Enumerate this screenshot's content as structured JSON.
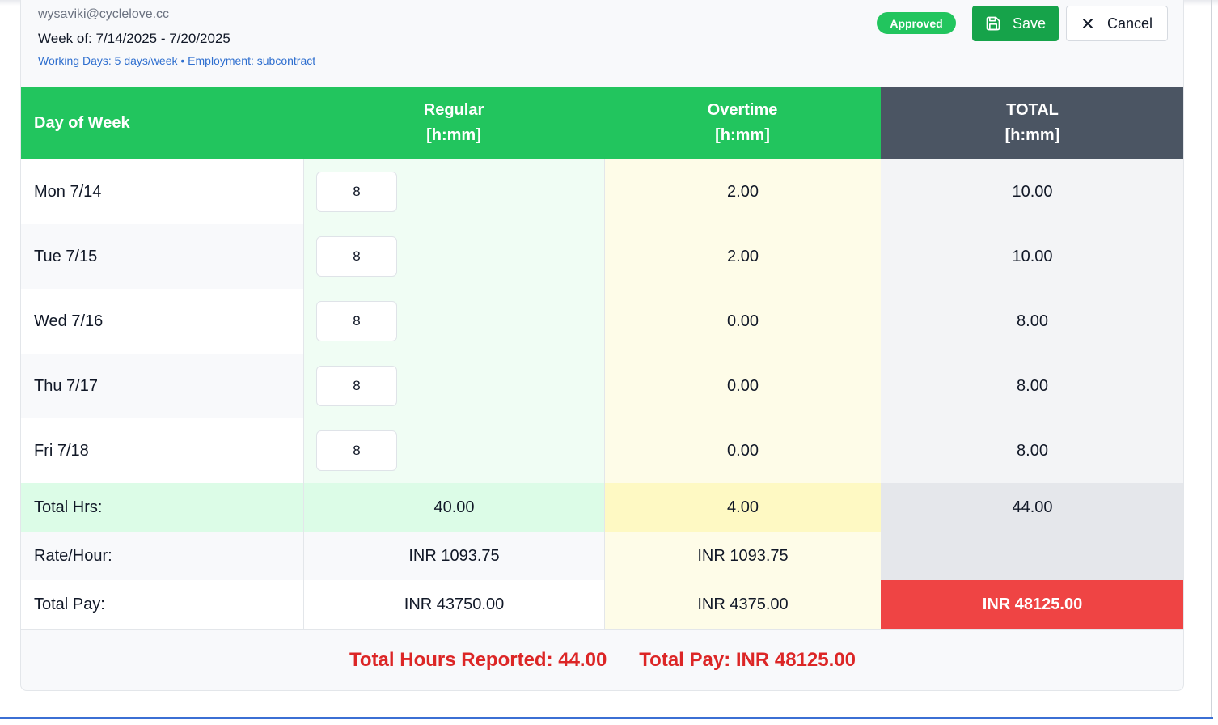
{
  "header": {
    "email": "wysaviki@cyclelove.cc",
    "week": "Week of: 7/14/2025 - 7/20/2025",
    "info": "Working Days: 5 days/week • Employment: subcontract",
    "status_badge": "Approved",
    "save_label": "Save",
    "cancel_label": "Cancel"
  },
  "table": {
    "headers": {
      "day": "Day of Week",
      "regular": "Regular",
      "regular_unit": "[h:mm]",
      "overtime": "Overtime",
      "overtime_unit": "[h:mm]",
      "total": "TOTAL",
      "total_unit": "[h:mm]"
    },
    "rows": [
      {
        "day": "Mon 7/14",
        "regular": "8",
        "overtime": "2.00",
        "total": "10.00"
      },
      {
        "day": "Tue 7/15",
        "regular": "8",
        "overtime": "2.00",
        "total": "10.00"
      },
      {
        "day": "Wed 7/16",
        "regular": "8",
        "overtime": "0.00",
        "total": "8.00"
      },
      {
        "day": "Thu 7/17",
        "regular": "8",
        "overtime": "0.00",
        "total": "8.00"
      },
      {
        "day": "Fri 7/18",
        "regular": "8",
        "overtime": "0.00",
        "total": "8.00"
      }
    ],
    "total_hrs": {
      "label": "Total Hrs:",
      "regular": "40.00",
      "overtime": "4.00",
      "total": "44.00"
    },
    "rate": {
      "label": "Rate/Hour:",
      "regular": "INR 1093.75",
      "overtime": "INR 1093.75",
      "total": ""
    },
    "total_pay": {
      "label": "Total Pay:",
      "regular": "INR 43750.00",
      "overtime": "INR 4375.00",
      "total": "INR 48125.00"
    }
  },
  "footer": {
    "hours_reported": "Total Hours Reported: 44.00",
    "total_pay": "Total Pay: INR 48125.00"
  },
  "colors": {
    "green": "#22c55e",
    "dark_green": "#16a34a",
    "slate": "#4b5563",
    "red": "#ef4444",
    "link_blue": "#2f6fcf"
  },
  "icons": {
    "save": "floppy-disk-icon",
    "cancel": "close-icon"
  }
}
